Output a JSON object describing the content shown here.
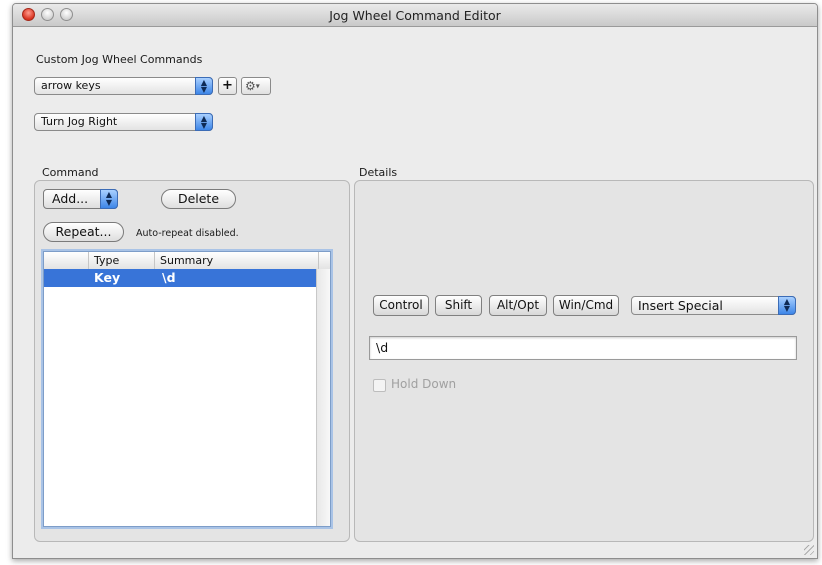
{
  "window": {
    "title": "Jog Wheel Command Editor"
  },
  "custom": {
    "heading": "Custom Jog Wheel Commands",
    "set_value": "arrow keys",
    "add_label": "+",
    "action_value": "Turn Jog Right"
  },
  "command": {
    "heading": "Command",
    "add_label": "Add...",
    "delete_label": "Delete",
    "repeat_label": "Repeat...",
    "repeat_status": "Auto-repeat disabled.",
    "columns": [
      "Type",
      "Summary"
    ],
    "rows": [
      {
        "type": "Key",
        "summary": "\\d"
      }
    ]
  },
  "details": {
    "heading": "Details",
    "modifiers": [
      "Control",
      "Shift",
      "Alt/Opt",
      "Win/Cmd"
    ],
    "insert_special": "Insert Special",
    "key_value": "\\d",
    "hold_down_label": "Hold Down",
    "hold_down_checked": false
  }
}
